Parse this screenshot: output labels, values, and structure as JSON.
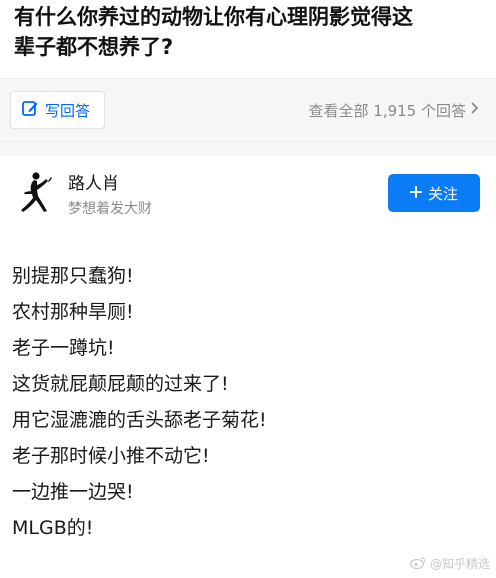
{
  "question": {
    "line1": "有什么你养过的动物让你有心理阴影觉得这",
    "line2": "辈子都不想养了?"
  },
  "actions": {
    "write_label": "写回答",
    "view_all_label": "查看全部 1,915 个回答",
    "write_icon": "edit-icon",
    "chevron_icon": "chevron-right-icon"
  },
  "author": {
    "name": "路人肖",
    "bio": "梦想着发大财",
    "follow_label": "关注",
    "avatar_icon": "jumpman-logo"
  },
  "answer": {
    "lines": [
      "别提那只蠢狗!",
      "农村那种旱厕!",
      "老子一蹲坑!",
      "这货就屁颠屁颠的过来了!",
      "用它湿漉漉的舌头舔老子菊花!",
      "老子那时候小推不动它!",
      "一边推一边哭!",
      "MLGB的!"
    ]
  },
  "watermark": {
    "text": "@知乎精选"
  },
  "colors": {
    "accent": "#0066ff",
    "follow_bg": "#0a7cf5",
    "muted": "#8a8a8a",
    "bar_bg": "#f6f6f6"
  }
}
